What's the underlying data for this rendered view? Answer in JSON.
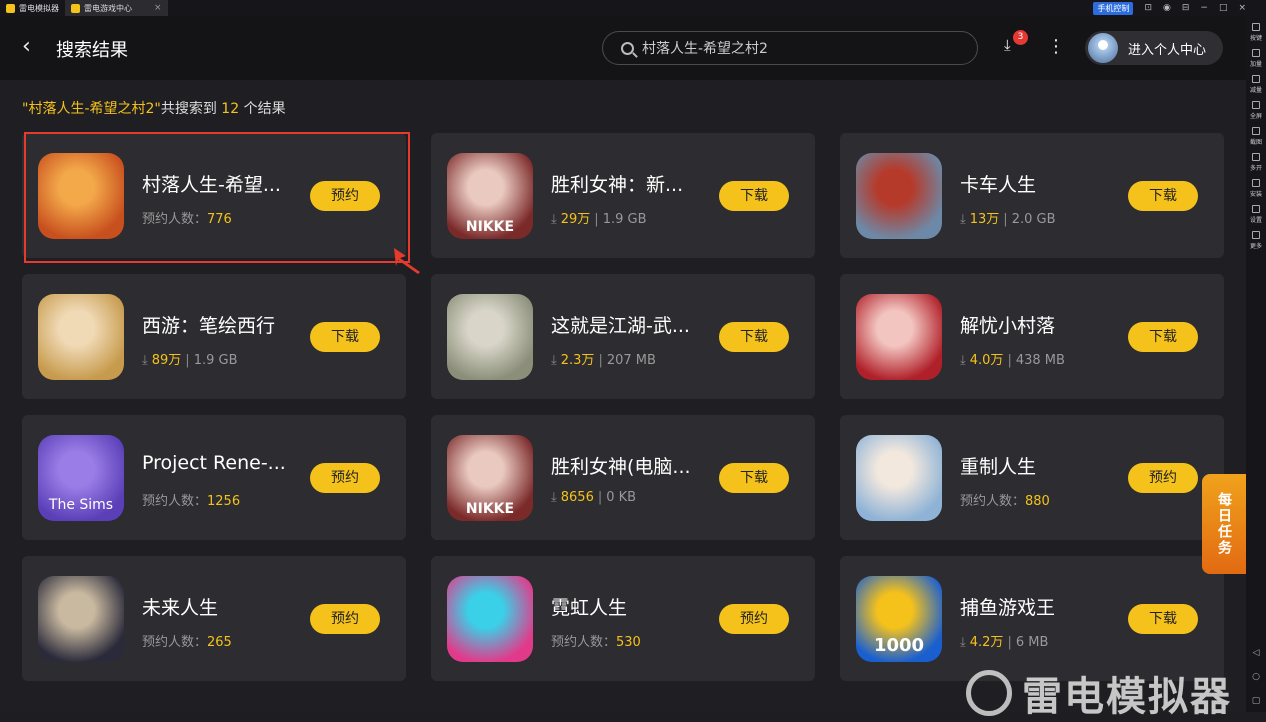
{
  "titlebar": {
    "tabs": [
      {
        "label": "雷电模拟器"
      },
      {
        "label": "雷电游戏中心",
        "close": "×"
      }
    ],
    "phone_control": "手机控制",
    "controls": [
      "⊟",
      "−",
      "□",
      "×"
    ]
  },
  "sidebar": {
    "items": [
      {
        "label": "按键"
      },
      {
        "label": "加量"
      },
      {
        "label": "减量"
      },
      {
        "label": "全屏"
      },
      {
        "label": "截图"
      },
      {
        "label": "多开"
      },
      {
        "label": "安装"
      },
      {
        "label": "设置"
      },
      {
        "label": "更多"
      }
    ],
    "bottom": [
      "◁",
      "○",
      "▢"
    ]
  },
  "header": {
    "back_icon": "‹",
    "title": "搜索结果",
    "search_value": "村落人生-希望之村2",
    "download_badge": "3",
    "user_label": "进入个人中心"
  },
  "summary": {
    "query": "\"村落人生-希望之村2\"",
    "prefix": "共搜索到 ",
    "count": "12",
    "suffix": " 个结果"
  },
  "results": [
    {
      "name": "村落人生-希望...",
      "meta_label": "预约人数：",
      "meta_value": "776",
      "action": "预约",
      "icon_colors": [
        "#c84f1e",
        "#f3a84a"
      ]
    },
    {
      "name": "胜利女神：新...",
      "downloads": "29万",
      "size": "1.9 GB",
      "action": "下载",
      "icon_colors": [
        "#7b2a2a",
        "#e9c9c0"
      ]
    },
    {
      "name": "卡车人生",
      "downloads": "13万",
      "size": "2.0 GB",
      "action": "下载",
      "icon_colors": [
        "#6c8aa8",
        "#b63a2a"
      ]
    },
    {
      "name": "西游：笔绘西行",
      "downloads": "89万",
      "size": "1.9 GB",
      "action": "下载",
      "icon_colors": [
        "#c79b4d",
        "#f0d9b5"
      ]
    },
    {
      "name": "这就是江湖-武...",
      "downloads": "2.3万",
      "size": "207 MB",
      "action": "下载",
      "icon_colors": [
        "#8b8f7a",
        "#d9d6c9"
      ]
    },
    {
      "name": "解忧小村落",
      "downloads": "4.0万",
      "size": "438 MB",
      "action": "下载",
      "icon_colors": [
        "#b0202a",
        "#f3c5c0"
      ]
    },
    {
      "name": "Project Rene-...",
      "meta_label": "预约人数：",
      "meta_value": "1256",
      "action": "预约",
      "icon_colors": [
        "#5a3fb8",
        "#9a7de6"
      ]
    },
    {
      "name": "胜利女神(电脑...",
      "downloads": "8656",
      "size": "0 KB",
      "action": "下载",
      "icon_colors": [
        "#7b2a2a",
        "#e9c9c0"
      ]
    },
    {
      "name": "重制人生",
      "meta_label": "预约人数：",
      "meta_value": "880",
      "action": "预约",
      "icon_colors": [
        "#8fb3d6",
        "#f2e8de"
      ]
    },
    {
      "name": "未来人生",
      "meta_label": "预约人数：",
      "meta_value": "265",
      "action": "预约",
      "icon_colors": [
        "#2a2a3a",
        "#c9b9a0"
      ]
    },
    {
      "name": "霓虹人生",
      "meta_label": "预约人数：",
      "meta_value": "530",
      "action": "预约",
      "icon_colors": [
        "#e23a8a",
        "#3ad0e8"
      ]
    },
    {
      "name": "捕鱼游戏王",
      "downloads": "4.2万",
      "size": "6 MB",
      "action": "下载",
      "icon_colors": [
        "#1a5fd0",
        "#f5c21c"
      ]
    }
  ],
  "icon_labels": {
    "nikke": "NIKKE",
    "the_sims": "The Sims",
    "fish": "1000"
  },
  "daily_task": "每日任务",
  "watermark": "雷电模拟器",
  "colors": {
    "accent": "#f5c21c",
    "highlight": "#e53b2c",
    "badge": "#e53935"
  }
}
